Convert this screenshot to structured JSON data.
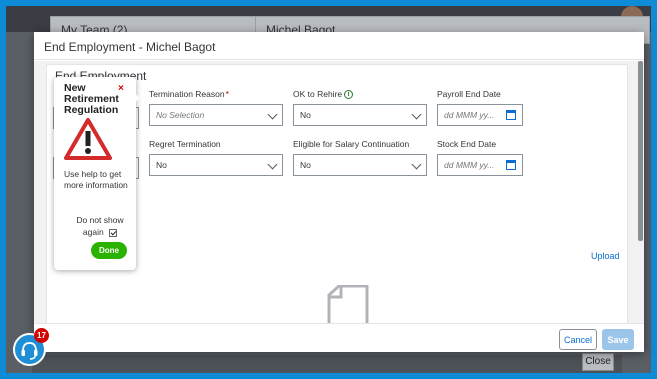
{
  "background": {
    "header_left": "My Team (2)",
    "header_right": "Michel Bagot",
    "close_label": "Close"
  },
  "dialog": {
    "title": "End Employment - Michel Bagot",
    "section_title": "End Employment",
    "fields": {
      "termination_reason": {
        "label": "Termination Reason",
        "required_mark": "*",
        "value": "No Selection"
      },
      "ok_to_rehire": {
        "label": "OK to Rehire",
        "info_icon": "i",
        "value": "No"
      },
      "payroll_end_date": {
        "label": "Payroll End Date",
        "placeholder": "dd MMM yy..."
      },
      "regret_termination": {
        "label": "Regret Termination",
        "value": "No"
      },
      "eligible_salary_continuation": {
        "label": "Eligible for Salary Continuation",
        "value": "No"
      },
      "stock_end_date": {
        "label": "Stock End Date",
        "placeholder": "dd MMM yy..."
      }
    },
    "upload_label": "Upload",
    "footer": {
      "cancel_label": "Cancel",
      "save_label": "Save"
    }
  },
  "callout": {
    "title": "New Retirement Regulation",
    "close_symbol": "×",
    "warning_icon": "warning-triangle",
    "body": "Use help to get more information",
    "do_not_show": "Do not show again",
    "done_label": "Done"
  },
  "help": {
    "badge_count": "17",
    "icon": "headset-icon"
  }
}
